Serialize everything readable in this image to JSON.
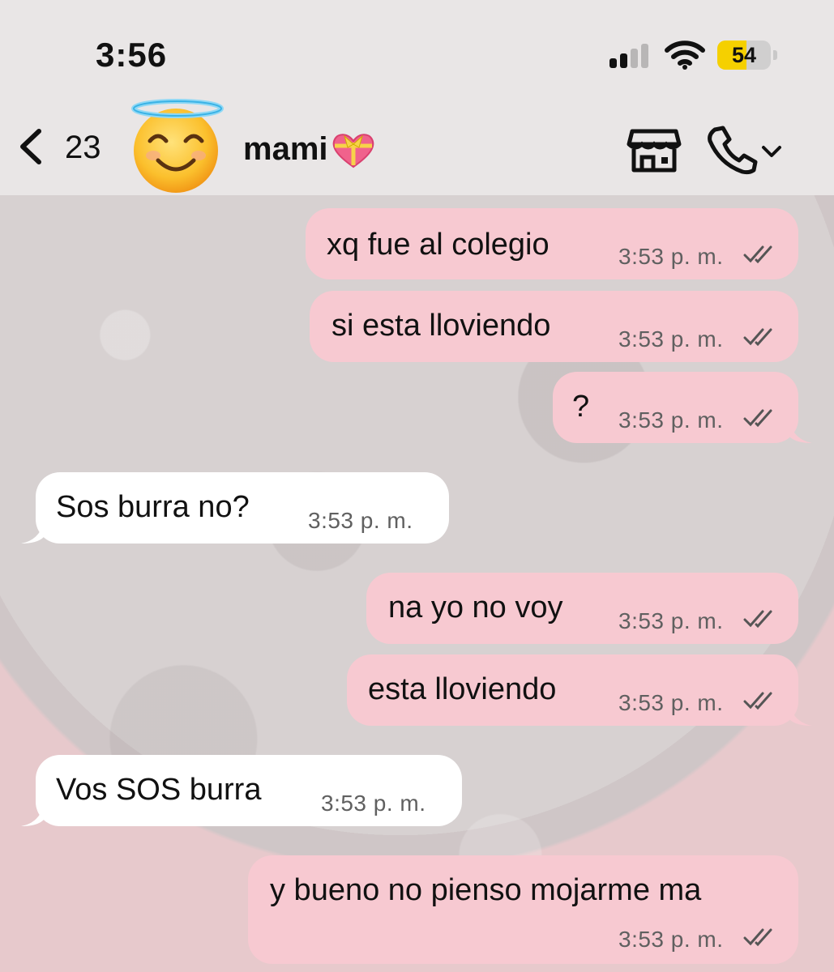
{
  "status_bar": {
    "time": "3:56",
    "battery_percent": "54",
    "battery_level": 0.54,
    "signal_bars_active": 2,
    "signal_bars_total": 4,
    "icons": [
      "signal-icon",
      "wifi-icon",
      "battery-icon"
    ]
  },
  "header": {
    "back_count": "23",
    "contact_name": "mami",
    "contact_name_emoji": "heart-with-ribbon",
    "avatar_emoji": "smiling-face-with-halo",
    "icons": [
      "back-chevron-icon",
      "store-icon",
      "phone-icon",
      "chevron-down-icon"
    ]
  },
  "messages": [
    {
      "direction": "out",
      "text": "xq fue al colegio",
      "time": "3:53 p. m.",
      "status": "read"
    },
    {
      "direction": "out",
      "text": "si esta lloviendo",
      "time": "3:53 p. m.",
      "status": "read"
    },
    {
      "direction": "out",
      "text": "?",
      "time": "3:53 p. m.",
      "status": "read"
    },
    {
      "direction": "in",
      "text": "Sos burra no?",
      "time": "3:53 p. m."
    },
    {
      "direction": "out",
      "text": "na yo no voy",
      "time": "3:53 p. m.",
      "status": "read"
    },
    {
      "direction": "out",
      "text": "esta lloviendo",
      "time": "3:53 p. m.",
      "status": "read"
    },
    {
      "direction": "in",
      "text": "Vos SOS burra",
      "time": "3:53 p. m."
    },
    {
      "direction": "out",
      "text": "y bueno no pienso mojarme ma",
      "time": "3:53 p. m.",
      "status": "read"
    }
  ],
  "colors": {
    "outgoing_bubble": "#f7c9d1",
    "incoming_bubble": "#ffffff",
    "header_bg": "#e9e6e6",
    "battery_fill": "#f5d000",
    "read_ticks": "#555555"
  }
}
